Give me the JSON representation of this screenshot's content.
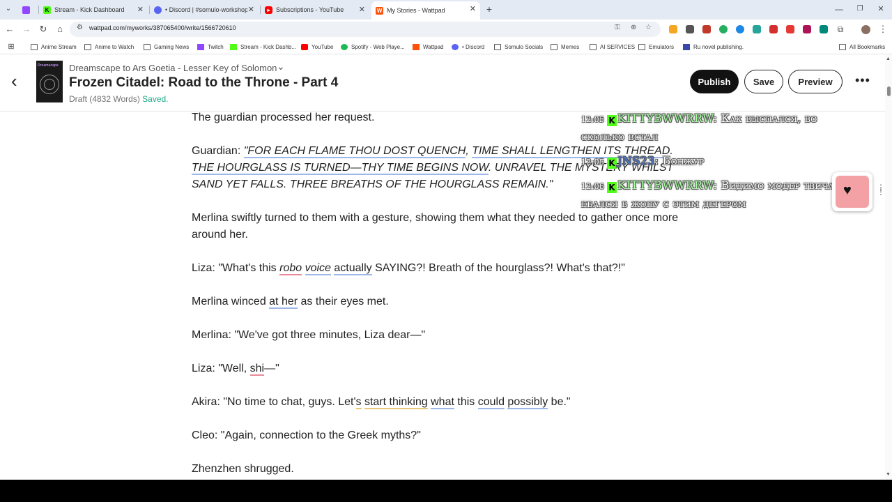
{
  "browser": {
    "tabs": [
      {
        "label": "Stream - Kick Dashboard",
        "icon": "kick-icon"
      },
      {
        "label": "• Discord | #somulo-workshop",
        "icon": "discord-icon"
      },
      {
        "label": "Subscriptions - YouTube",
        "icon": "youtube-icon"
      },
      {
        "label": "My Stories - Wattpad",
        "icon": "wattpad-icon"
      }
    ],
    "url": "wattpad.com/myworks/387065400/write/1566720610",
    "bookmarks": [
      {
        "label": "Anime Stream",
        "type": "folder"
      },
      {
        "label": "Anime to Watch",
        "type": "folder"
      },
      {
        "label": "Gaming News",
        "type": "folder"
      },
      {
        "label": "Twitch",
        "type": "twitch"
      },
      {
        "label": "Stream - Kick Dashb...",
        "type": "kick"
      },
      {
        "label": "YouTube",
        "type": "youtube"
      },
      {
        "label": "Spotify - Web Playe...",
        "type": "spotify"
      },
      {
        "label": "Wattpad",
        "type": "wattpad"
      },
      {
        "label": "• Discord",
        "type": "discord"
      },
      {
        "label": "Somulo Socials",
        "type": "folder"
      },
      {
        "label": "Memes",
        "type": "folder"
      },
      {
        "label": "AI SERVICES",
        "type": "folder"
      },
      {
        "label": "Emulators",
        "type": "folder"
      },
      {
        "label": "Ru novel publishing.",
        "type": "page"
      }
    ],
    "all_bookmarks": "All Bookmarks"
  },
  "header": {
    "story_title": "Dreamscape to Ars Goetia - Lesser Key of Solomon",
    "part_title": "Frozen Citadel: Road to the Throne - Part 4",
    "draft_info": "Draft (4832 Words)",
    "saved_label": "Saved.",
    "publish_label": "Publish",
    "save_label": "Save",
    "preview_label": "Preview",
    "cover_text": "Dreamscape"
  },
  "editor": {
    "p1": "The guardian processed her request.",
    "p2_speaker": "Guardian: ",
    "p2_a": "\"FOR EACH FLAME THOU DOST QUENCH",
    "p2_b": ", ",
    "p2_c": "TIME SHALL LENGTHEN ITS THREAD",
    "p2_d": ". ",
    "p2_e": "THE HOURGLASS IS TURNED—THY TIME BEGINS NOW",
    "p2_f": ". UNRAVEL THE MYSTERY WHILST SAND YET FALLS. THREE BREATHS OF THE HOURGLASS REMAIN.\"",
    "p3": "Merlina swiftly turned to them with a gesture, showing them what they needed to gather once more around her.",
    "p4_a": "Liza: \"What's this ",
    "p4_b": "robo",
    "p4_c": " ",
    "p4_d": "voice",
    "p4_e": " ",
    "p4_f": "actually",
    "p4_g": " SAYING?! Breath of the hourglass?! What's that?!\"",
    "p5_a": "Merlina winced ",
    "p5_b": "at her",
    "p5_c": " as their eyes met.",
    "p6": "Merlina: \"We've got three minutes, Liza dear—\"",
    "p7_a": "Liza: \"Well, ",
    "p7_b": "shi",
    "p7_c": "—\"",
    "p8_a": "Akira: \"No time to chat, guys. Let'",
    "p8_b": "s",
    "p8_c": " ",
    "p8_d": "start thinking",
    "p8_e": " ",
    "p8_f": "what",
    "p8_g": " this ",
    "p8_h": "could",
    "p8_i": " ",
    "p8_j": "possibly",
    "p8_k": " be.\"",
    "p9": "Cleo: \"Again, connection to the Greek myths?\"",
    "p10": "Zhenzhen shrugged."
  },
  "chat": [
    {
      "time": "12:05",
      "user": "KITTYBWWRRW",
      "message": ": Как выспался, во",
      "message_cont": "сколько встал"
    },
    {
      "time": "12:05",
      "user": "JNS23",
      "message": ": Бонжур"
    },
    {
      "time": "12:06",
      "user": "KITTYBWWRRW",
      "message": ": Видимо модер твича",
      "message_cont": "ебался в жопу с этим дегером"
    }
  ],
  "colors": {
    "kick_green": "#53fc18",
    "publish_bg": "#121212",
    "saved_green": "#1ba885",
    "float_pink": "#f3a1a5"
  }
}
